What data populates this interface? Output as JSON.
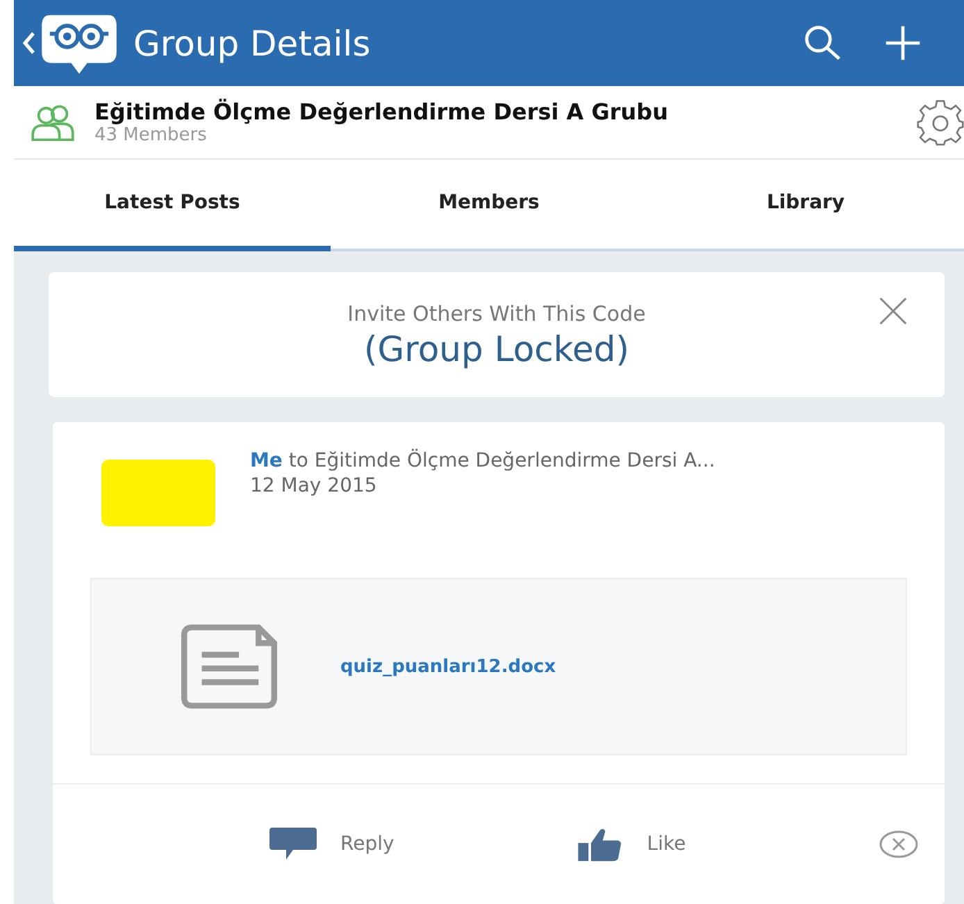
{
  "header": {
    "title": "Group Details"
  },
  "group": {
    "name": "Eğitimde Ölçme Değerlendirme Dersi A Grubu",
    "members": "43 Members"
  },
  "tabs": [
    {
      "label": "Latest Posts",
      "selected": true
    },
    {
      "label": "Members",
      "selected": false
    },
    {
      "label": "Library",
      "selected": false
    }
  ],
  "invite": {
    "label": "Invite Others With This Code",
    "code": "(Group Locked)"
  },
  "post": {
    "author": "Me",
    "target": "to Eğitimde Ölçme Değerlendirme Dersi A...",
    "date": "12 May 2015",
    "attachment": {
      "name": "quiz_puanları12.docx"
    },
    "actions": [
      {
        "kind": "reply",
        "label": "Reply"
      },
      {
        "kind": "like",
        "label": "Like"
      }
    ]
  }
}
